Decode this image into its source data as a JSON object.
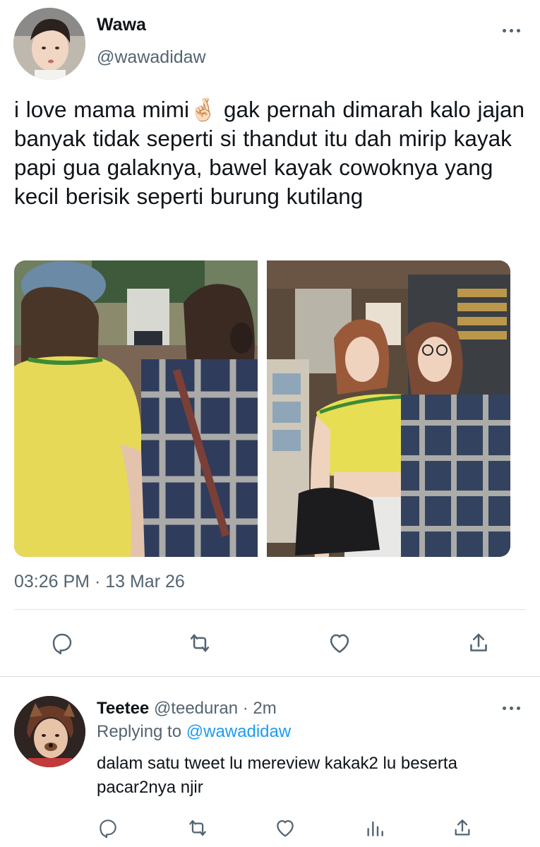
{
  "tweet": {
    "author_name": "Wawa",
    "author_handle": "@wawadidaw",
    "text_before_emoji": "i love mama mimi",
    "emoji": "🤞🏻",
    "text_after_emoji": " gak pernah dimarah kalo jajan banyak tidak seperti si thandut itu dah mirip kayak papi gua galaknya, bawel kayak cowoknya yang kecil berisik seperti burung kutilang",
    "timestamp": "03:26 PM · 13 Mar 26",
    "photos": [
      "photo-left",
      "photo-right"
    ],
    "actions": [
      "reply-icon",
      "retweet-icon",
      "like-icon",
      "share-icon"
    ]
  },
  "reply": {
    "author_name": "Teetee",
    "author_handle": "@teeduran",
    "separator": " · ",
    "time": "2m",
    "replying_prefix": "Replying to ",
    "replying_to": "@wawadidaw",
    "text": "dalam satu tweet lu mereview kakak2 lu beserta pacar2nya njir",
    "actions": [
      "reply-icon",
      "retweet-icon",
      "like-icon",
      "analytics-icon",
      "share-icon"
    ]
  },
  "colors": {
    "text": "#0f1419",
    "secondary": "#536471",
    "link": "#1d9bf0",
    "divider": "#e1e6ea"
  }
}
